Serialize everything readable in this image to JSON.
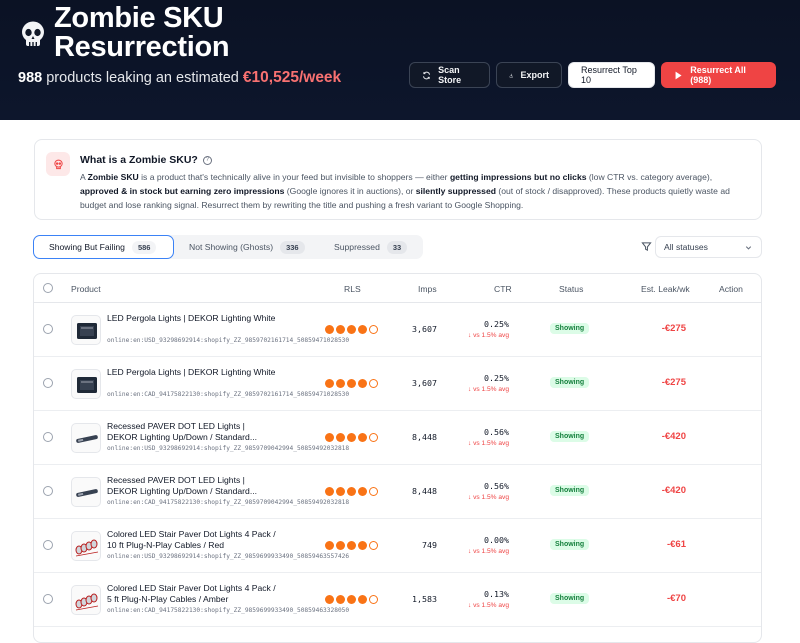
{
  "header": {
    "title": "Zombie SKU Resurrection",
    "summary_count": "988",
    "summary_text": "products leaking an estimated",
    "summary_amount": "€10,525/week",
    "buttons": {
      "scan": "Scan Store",
      "export": "Export",
      "top10": "Resurrect Top 10",
      "all": "Resurrect All (988)"
    }
  },
  "info": {
    "heading": "What is a Zombie SKU?",
    "p1": "A ",
    "b1": "Zombie SKU",
    "p2": " is a product that's technically alive in your feed but invisible to shoppers — either ",
    "b2": "getting impressions but no clicks",
    "p3": " (low CTR vs. category average), ",
    "b3": "approved & in stock but earning zero impressions",
    "p4": " (Google ignores it in auctions), or ",
    "b4": "silently suppressed",
    "p5": " (out of stock / disapproved). These products quietly waste ad budget and lose ranking signal. Resurrect them by rewriting the title and pushing a fresh variant to Google Shopping."
  },
  "tabs": [
    {
      "label": "Showing But Failing",
      "count": "586"
    },
    {
      "label": "Not Showing (Ghosts)",
      "count": "336"
    },
    {
      "label": "Suppressed",
      "count": "33"
    }
  ],
  "filter": {
    "selected": "All statuses"
  },
  "columns": {
    "product": "Product",
    "rls": "RLS",
    "imps": "Imps",
    "ctr": "CTR",
    "status": "Status",
    "leak": "Est. Leak/wk",
    "action": "Action"
  },
  "rows": [
    {
      "name": "LED Pergola Lights | DEKOR Lighting White",
      "id": "online:en:USD_93298692914:shopify_ZZ_9859702161714_50859471028530",
      "rls": 4,
      "imps": "3,607",
      "ctr": "0.25%",
      "ctr_note": "vs 1.5% avg",
      "status": "Showing",
      "leak": "-€275",
      "thumb": "box"
    },
    {
      "name": "LED Pergola Lights | DEKOR Lighting White",
      "id": "online:en:CAD_94175822130:shopify_ZZ_9859702161714_50859471028530",
      "rls": 4,
      "imps": "3,607",
      "ctr": "0.25%",
      "ctr_note": "vs 1.5% avg",
      "status": "Showing",
      "leak": "-€275",
      "thumb": "box"
    },
    {
      "name": "Recessed PAVER DOT LED Lights | DEKOR Lighting Up/Down / Standard...",
      "id": "online:en:USD_93298692914:shopify_ZZ_9859709042994_50859492032818",
      "rls": 4,
      "imps": "8,448",
      "ctr": "0.56%",
      "ctr_note": "vs 1.5% avg",
      "status": "Showing",
      "leak": "-€420",
      "thumb": "bar"
    },
    {
      "name": "Recessed PAVER DOT LED Lights | DEKOR Lighting Up/Down / Standard...",
      "id": "online:en:CAD_94175822130:shopify_ZZ_9859709042994_50859492032818",
      "rls": 4,
      "imps": "8,448",
      "ctr": "0.56%",
      "ctr_note": "vs 1.5% avg",
      "status": "Showing",
      "leak": "-€420",
      "thumb": "bar"
    },
    {
      "name": "Colored LED Stair Paver Dot Lights 4 Pack / 10 ft Plug-N-Play Cables / Red",
      "id": "online:en:USD_93298692914:shopify_ZZ_9859699933490_50859463557426",
      "rls": 4,
      "imps": "749",
      "ctr": "0.00%",
      "ctr_note": "vs 1.5% avg",
      "status": "Showing",
      "leak": "-€61",
      "thumb": "pucks"
    },
    {
      "name": "Colored LED Stair Paver Dot Lights 4 Pack / 5 ft Plug-N-Play Cables / Amber",
      "id": "online:en:CAD_94175822130:shopify_ZZ_9859699933490_50859463328050",
      "rls": 4,
      "imps": "1,583",
      "ctr": "0.13%",
      "ctr_note": "vs 1.5% avg",
      "status": "Showing",
      "leak": "-€70",
      "thumb": "pucks"
    }
  ]
}
